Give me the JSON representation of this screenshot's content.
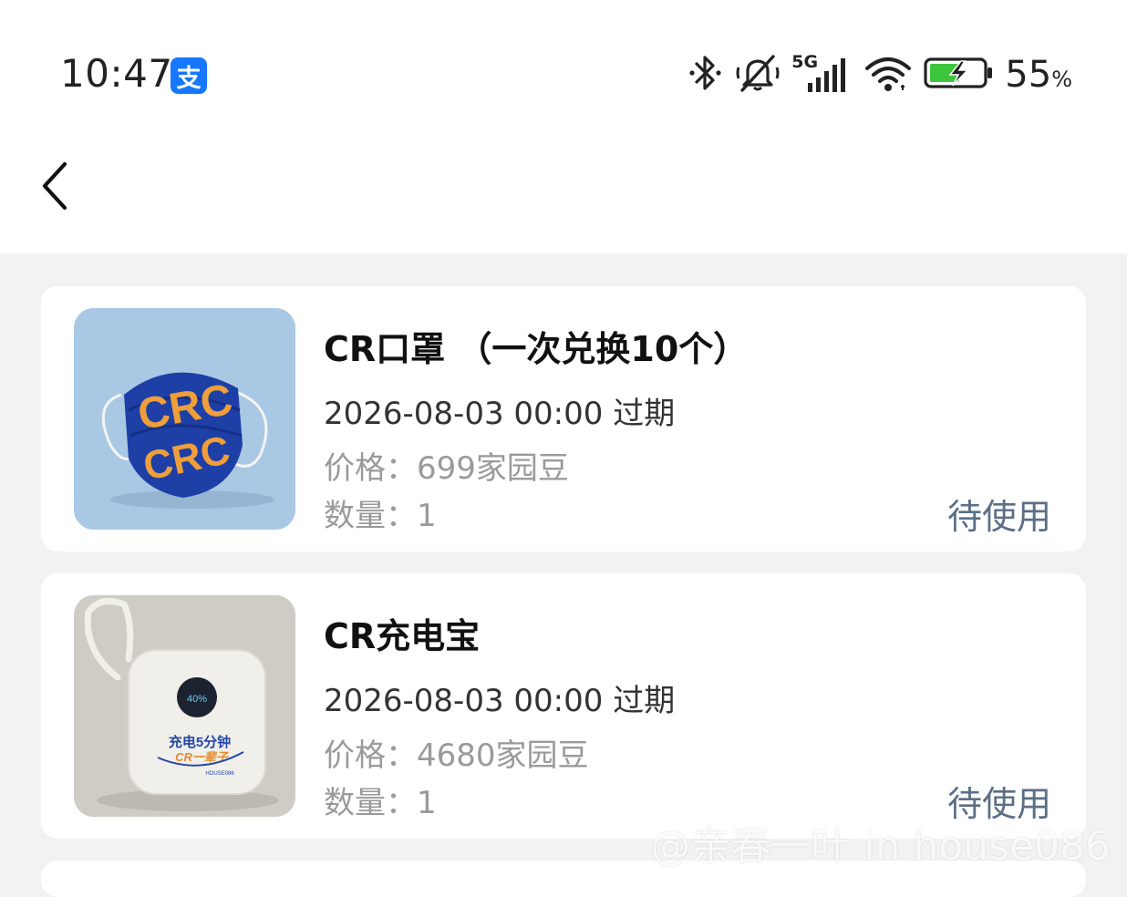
{
  "status_bar": {
    "time": "10:47",
    "alipay_glyph": "支",
    "network_label": "5G",
    "battery_percent": "55",
    "percent_sign": "%",
    "icons": [
      "bluetooth-icon",
      "mute-icon",
      "signal-icon",
      "wifi-icon",
      "battery-charging-icon"
    ]
  },
  "nav": {
    "back_icon": "chevron-left-icon"
  },
  "items": [
    {
      "title": "CR口罩 （一次兑换10个）",
      "expiry": "2026-08-03 00:00 过期",
      "price_label": "价格：",
      "price_value": "699家园豆",
      "qty_label": "数量：",
      "qty_value": "1",
      "status": "待使用",
      "thumb_letters": "CRC"
    },
    {
      "title": "CR充电宝",
      "expiry": "2026-08-03 00:00 过期",
      "price_label": "价格：",
      "price_value": "4680家园豆",
      "qty_label": "数量：",
      "qty_value": "1",
      "status": "待使用",
      "thumb_display": "40%",
      "thumb_line1": "充电5分钟",
      "thumb_line2": "CR一辈子",
      "thumb_brand": "HOUSE086"
    }
  ],
  "watermark": "@亲春一叶 in house086",
  "colors": {
    "accent_status": "#5a6f86",
    "page_bg": "#f2f2f2",
    "alipay_blue": "#1677ff"
  }
}
